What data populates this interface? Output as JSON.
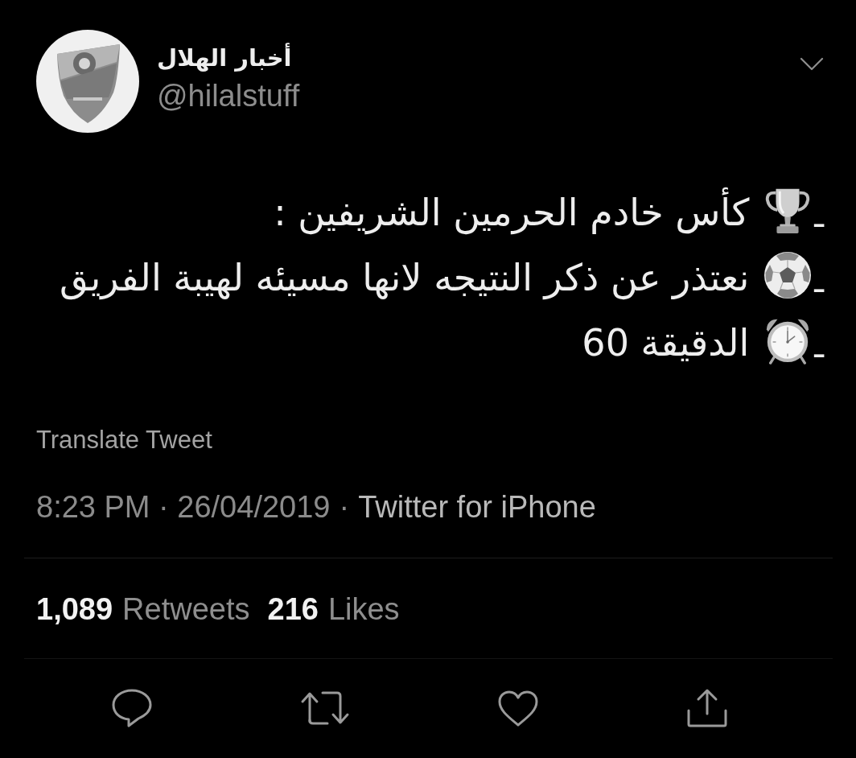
{
  "tweet": {
    "author": {
      "name": "أخبار الهلال",
      "handle": "@hilalstuff"
    },
    "lines": [
      {
        "lead": "ـ",
        "text": "كأس خادم الحرمين الشريفين :"
      },
      {
        "lead": "ـ",
        "text": "نعتذر عن ذكر النتيجه لانها مسيئه لهيبة الفريق"
      },
      {
        "lead": "ـ",
        "text": "الدقيقة 60"
      }
    ],
    "translate": "Translate Tweet",
    "meta": {
      "timestamp": "8:23 PM · 26/04/2019",
      "separator": "·",
      "source": "Twitter for iPhone"
    },
    "stats": {
      "retweets": {
        "count": "1,089",
        "label": "Retweets"
      },
      "likes": {
        "count": "216",
        "label": "Likes"
      }
    }
  }
}
